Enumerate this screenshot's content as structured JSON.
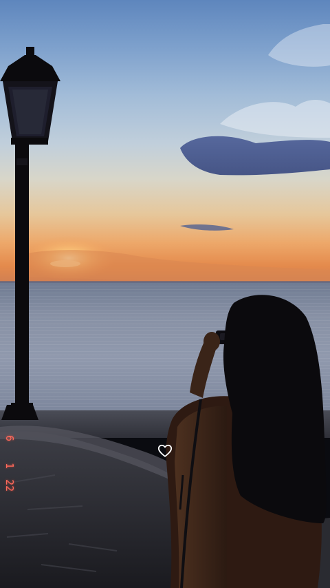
{
  "photo": {
    "scene": "sunset-over-sea",
    "colors": {
      "sky_top": "#5e86bd",
      "horizon_glow": "#e48a4c",
      "sea": "#8891a5",
      "silhouette": "#0b0a0d",
      "date_stamp": "#ff6a5c"
    }
  },
  "date_stamp": {
    "part1": "6",
    "part2": "1",
    "part3": "22"
  },
  "overlay": {
    "heart_icon": "heart-outline-icon"
  }
}
